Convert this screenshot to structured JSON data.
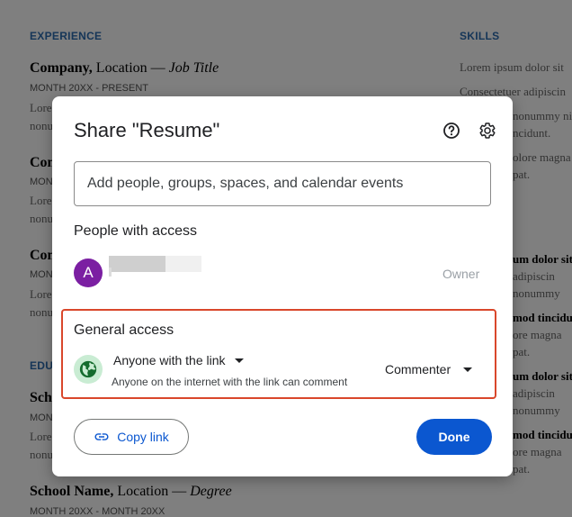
{
  "background_doc": {
    "experience_heading": "EXPERIENCE",
    "skills_heading": "SKILLS",
    "education_heading": "EDU",
    "entry1": {
      "company": "Company,",
      "location": " Location — ",
      "role": "Job Title",
      "date": "MONTH 20XX - PRESENT",
      "line1": "Lore",
      "line2": "nonu"
    },
    "entry2": {
      "company": "Com",
      "date": "MON",
      "line1": "Lore",
      "line2": "nonu"
    },
    "entry3": {
      "company": "Com",
      "date": "MON",
      "line1": "Lore",
      "line2": "nonu"
    },
    "school1": {
      "name": "Scho",
      "date": "MON",
      "line1": "Lore",
      "line2": "nonu"
    },
    "school2": {
      "name": "School Name,",
      "location": " Location — ",
      "degree": "Degree",
      "date": "MONTH 20XX - MONTH 20XX"
    },
    "skills_lines": [
      "Lorem ipsum dolor sit",
      "Consectetuer adipiscin",
      "nonummy ni",
      "ncidunt.",
      "olore magna",
      "pat.",
      "um dolor sit",
      "adipiscin",
      "nonummy",
      "mod tincidu",
      "ore magna",
      "pat.",
      "um dolor sit",
      "adipiscin",
      "nonummy",
      "mod tincidu",
      "ore magna",
      "pat."
    ]
  },
  "dialog": {
    "title": "Share \"Resume\"",
    "help_icon": "help-circle-icon",
    "settings_icon": "gear-icon",
    "add_people_placeholder": "Add people, groups, spaces, and calendar events",
    "people_heading": "People with access",
    "person": {
      "avatar_letter": "A",
      "avatar_color": "#7b1fa2",
      "role": "Owner"
    },
    "general_access": {
      "heading": "General access",
      "link_setting": "Anyone with the link",
      "description": "Anyone on the internet with the link can comment",
      "role": "Commenter",
      "globe_icon": "globe-icon",
      "highlight_color": "#d9472b"
    },
    "copy_link_label": "Copy link",
    "copy_link_icon": "link-icon",
    "done_label": "Done",
    "accent_color": "#0b57d0"
  }
}
